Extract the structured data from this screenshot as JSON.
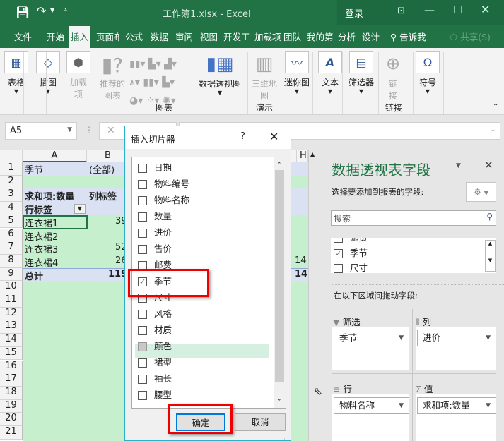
{
  "window": {
    "title": "工作簿1.xlsx  -  Excel",
    "login": "登录"
  },
  "tabs": [
    "文件",
    "开始",
    "插入",
    "页面布",
    "公式",
    "数据",
    "审阅",
    "视图",
    "开发工",
    "加载项",
    "团队",
    "我的第",
    "分析",
    "设计"
  ],
  "tell_me": "告诉我",
  "share": "共享(S)",
  "ribbon": {
    "table": "表格",
    "illustrations": "插图",
    "addins": "加载项",
    "recommended_charts": "推荐的图表",
    "pivot_chart": "数据透视图",
    "map3d": "三维地图",
    "sparklines": "迷你图",
    "text": "文本",
    "filters": "筛选器",
    "link": "链接",
    "symbols": "符号",
    "group_charts": "图表",
    "group_tours": "演示",
    "group_links": "链接"
  },
  "formula_bar": {
    "name_box": "A5"
  },
  "grid": {
    "columns": [
      "A",
      "B",
      "H"
    ],
    "rows": [
      "1",
      "2",
      "3",
      "4",
      "5",
      "6",
      "7",
      "8",
      "9",
      "10",
      "11",
      "12",
      "13",
      "14",
      "15",
      "16",
      "17",
      "18",
      "19",
      "20",
      "21"
    ],
    "cells": {
      "a1": "季节",
      "b1": "(全部)",
      "a3": "求和项:数量",
      "b3": "列标签",
      "a4": "行标签",
      "a5": "连衣裙1",
      "b5": "39",
      "a6": "连衣裙2",
      "a7": "连衣裙3",
      "b7": "52",
      "a8": "连衣裙4",
      "b8": "26",
      "h8": "14",
      "a9": "总计",
      "b9": "119",
      "h9": "14"
    }
  },
  "dialog": {
    "title": "插入切片器",
    "help": "?",
    "items": [
      {
        "label": "日期",
        "checked": false
      },
      {
        "label": "物料编号",
        "checked": false
      },
      {
        "label": "物料名称",
        "checked": false
      },
      {
        "label": "数量",
        "checked": false
      },
      {
        "label": "进价",
        "checked": false
      },
      {
        "label": "售价",
        "checked": false
      },
      {
        "label": "邮费",
        "checked": false
      },
      {
        "label": "季节",
        "checked": true
      },
      {
        "label": "尺寸",
        "checked": false
      },
      {
        "label": "风格",
        "checked": false
      },
      {
        "label": "材质",
        "checked": false
      },
      {
        "label": "颜色",
        "checked": false
      },
      {
        "label": "裙型",
        "checked": false
      },
      {
        "label": "袖长",
        "checked": false
      },
      {
        "label": "腰型",
        "checked": false
      }
    ],
    "ok": "确定",
    "cancel": "取消"
  },
  "panel": {
    "title": "数据透视表字段",
    "subtitle": "选择要添加到报表的字段:",
    "search_placeholder": "搜索",
    "fields": [
      {
        "label": "邮费",
        "checked": false
      },
      {
        "label": "季节",
        "checked": true
      },
      {
        "label": "尺寸",
        "checked": false
      }
    ],
    "drag_label": "在以下区域间拖动字段:",
    "filters": {
      "label": "筛选",
      "value": "季节"
    },
    "columns": {
      "label": "列",
      "value": "进价"
    },
    "rows": {
      "label": "行",
      "value": "物料名称"
    },
    "values": {
      "label": "值",
      "value": "求和项:数量"
    }
  },
  "colors": {
    "brand": "#217346",
    "pivot_header": "#d9e1f2",
    "pivot_body": "#c6efce",
    "highlight": "#ff0000"
  }
}
